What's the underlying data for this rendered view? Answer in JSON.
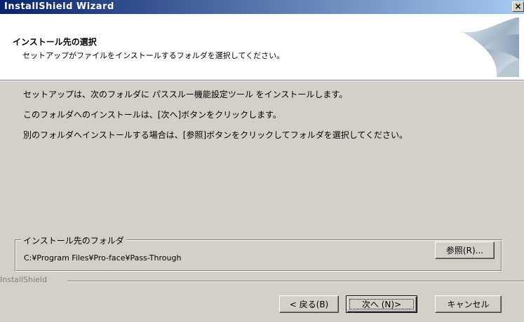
{
  "window": {
    "title": "InstallShield Wizard",
    "close_glyph": "×"
  },
  "header": {
    "title": "インストール先の選択",
    "subtitle": "セットアップがファイルをインストールするフォルダを選択してください。"
  },
  "body": {
    "line1": "セットアップは、次のフォルダに パススルー機能設定ツール をインストールします。",
    "line2": "このフォルダへのインストールは、[次へ]ボタンをクリックします。",
    "line3": "別のフォルダへインストールする場合は、[参照]ボタンをクリックしてフォルダを選択してください。"
  },
  "destination": {
    "group_label": "インストール先のフォルダ",
    "path": "C:¥Program Files¥Pro-face¥Pass-Through",
    "browse_label": "参照(R)..."
  },
  "footer": {
    "brand": "InstallShield",
    "back_label": "< 戻る(B)",
    "next_label": "次へ (N)>",
    "cancel_label": "キャンセル"
  },
  "colors": {
    "titlebar_start": "#0a246a",
    "titlebar_end": "#a6caf0",
    "face": "#d4d0c8"
  },
  "icons": {
    "header_art": "installshield-swoosh-icon"
  }
}
